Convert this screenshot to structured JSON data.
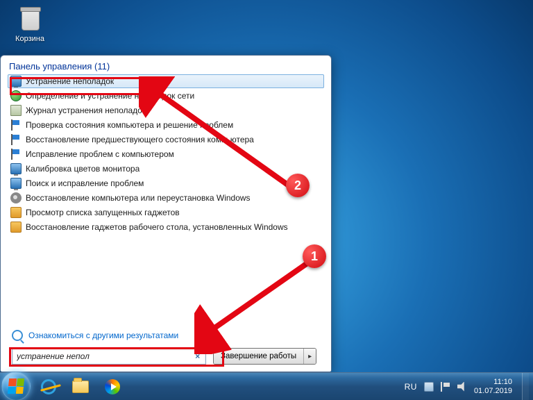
{
  "desktop": {
    "recycle_bin_label": "Корзина"
  },
  "start_menu": {
    "header": "Панель управления (11)",
    "results": [
      "Устранение неполадок",
      "Определение и устранение неполадок сети",
      "Журнал устранения неполадок",
      "Проверка состояния компьютера и решение проблем",
      "Восстановление предшествующего состояния компьютера",
      "Исправление проблем с компьютером",
      "Калибровка цветов монитора",
      "Поиск и исправление проблем",
      "Восстановление компьютера или переустановка Windows",
      "Просмотр списка запущенных гаджетов",
      "Восстановление гаджетов рабочего стола, установленных Windows"
    ],
    "more_results": "Ознакомиться с другими результатами",
    "search_value": "устранение непол",
    "clear": "×",
    "shutdown": "Завершение работы"
  },
  "annotations": {
    "step1": "1",
    "step2": "2"
  },
  "taskbar": {
    "lang": "RU",
    "time": "11:10",
    "date": "01.07.2019"
  }
}
